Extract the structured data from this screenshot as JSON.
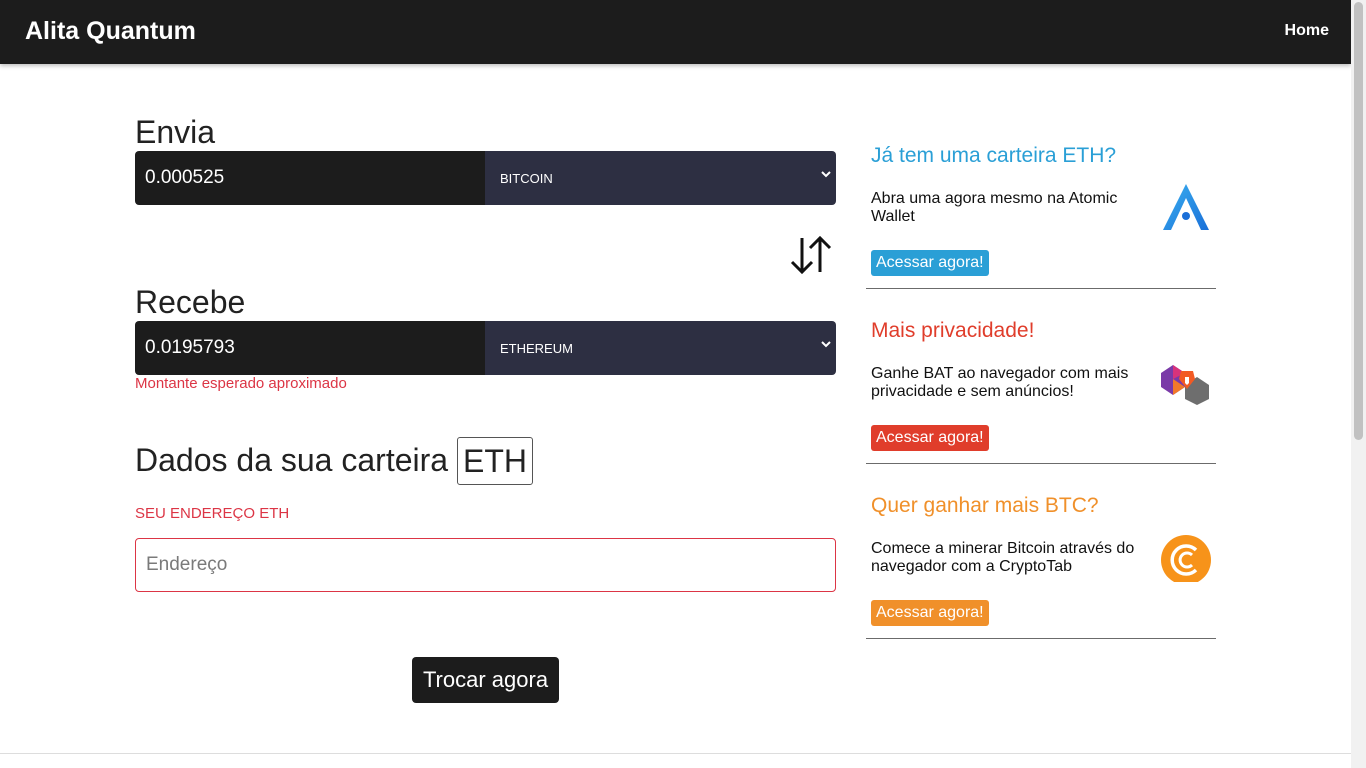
{
  "nav": {
    "brand": "Alita Quantum",
    "home": "Home"
  },
  "send": {
    "title": "Envia",
    "amount": "0.000525",
    "coin": "BITCOIN"
  },
  "receive": {
    "title": "Recebe",
    "amount": "0.0195793",
    "coin": "ETHEREUM",
    "hint": "Montante esperado aproximado"
  },
  "wallet": {
    "title": "Dados da sua carteira",
    "badge": "ETH",
    "address_label": "SEU ENDEREÇO ETH",
    "address_placeholder": "Endereço",
    "address_value": ""
  },
  "submit_label": "Trocar agora",
  "cards": [
    {
      "title": "Já tem uma carteira ETH?",
      "text": "Abra uma agora mesmo na Atomic Wallet",
      "button": "Acessar agora!",
      "color": "#2a9fd6",
      "icon": "atomic-wallet-logo"
    },
    {
      "title": "Mais privacidade!",
      "text": "Ganhe BAT ao navegador com mais privacidade e sem anúncios!",
      "button": "Acessar agora!",
      "color": "#e03d2b",
      "icon": "brave-browser-logo"
    },
    {
      "title": "Quer ganhar mais BTC?",
      "text": "Comece a minerar Bitcoin através do navegador com a CryptoTab",
      "button": "Acessar agora!",
      "color": "#f0902a",
      "icon": "cryptotab-logo"
    }
  ],
  "colors": {
    "navbar": "#1c1c1c",
    "select_bg": "#2d2f42",
    "error": "#dc3545"
  }
}
